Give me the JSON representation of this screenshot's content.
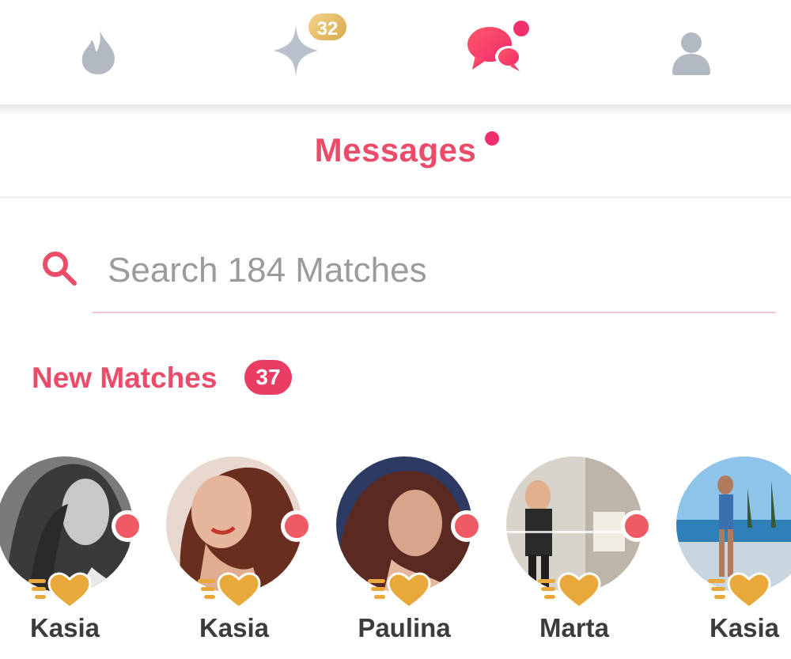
{
  "nav": {
    "items": [
      {
        "name": "flame-icon"
      },
      {
        "name": "gold-sparkle-icon",
        "badge": "32"
      },
      {
        "name": "chat-bubbles-icon",
        "active": true
      },
      {
        "name": "profile-icon"
      }
    ],
    "colors": {
      "inactive": "#b3b9c2",
      "active": "#f3466e",
      "gold": "#d9a94a"
    }
  },
  "header": {
    "title": "Messages"
  },
  "search": {
    "placeholder": "Search 184 Matches",
    "value": ""
  },
  "new_matches": {
    "label": "New Matches",
    "count": "37",
    "items": [
      {
        "name": "Kasia"
      },
      {
        "name": "Kasia"
      },
      {
        "name": "Paulina"
      },
      {
        "name": "Marta"
      },
      {
        "name": "Kasia"
      }
    ]
  },
  "colors": {
    "brand": "#ea4c6a",
    "online": "#ef5b64",
    "like": "#e8a93a"
  }
}
